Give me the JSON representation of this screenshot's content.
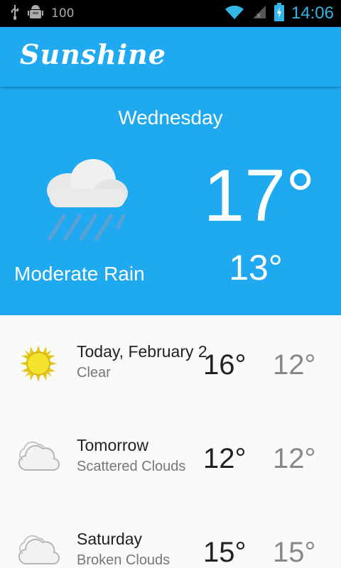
{
  "status_bar": {
    "battery_percent": "100",
    "time": "14:06",
    "icons": [
      "usb-icon",
      "android-debug-icon",
      "wifi-icon",
      "signal-icon",
      "battery-charging-icon"
    ]
  },
  "app": {
    "title": "Sunshine",
    "accent_color": "#1ea9f0"
  },
  "today": {
    "day": "Wednesday",
    "description": "Moderate Rain",
    "high": "17°",
    "low": "13°",
    "icon": "rain-cloud-icon"
  },
  "forecast": [
    {
      "date": "Today, February 2",
      "description": "Clear",
      "high": "16°",
      "low": "12°",
      "icon": "sun-icon"
    },
    {
      "date": "Tomorrow",
      "description": "Scattered Clouds",
      "high": "12°",
      "low": "12°",
      "icon": "cloud-icon"
    },
    {
      "date": "Saturday",
      "description": "Broken Clouds",
      "high": "15°",
      "low": "15°",
      "icon": "cloud-icon"
    }
  ]
}
